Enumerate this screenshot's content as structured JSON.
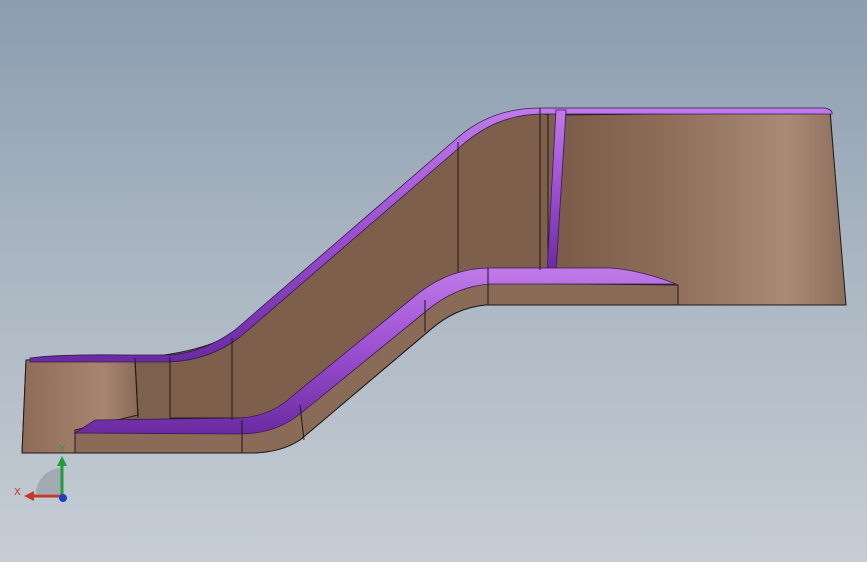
{
  "view": {
    "background_top": "#8b9db0",
    "background_bottom": "#c6cdd5"
  },
  "model": {
    "body_color": "#8a6a55",
    "fillet_color": "#9a4fd0",
    "edge_color": "#1a1a1a"
  },
  "triad": {
    "x_label": "X",
    "y_label": "Y",
    "x_color": "#c0392b",
    "y_color": "#1e9e3a",
    "z_color": "#1f3fbf"
  }
}
